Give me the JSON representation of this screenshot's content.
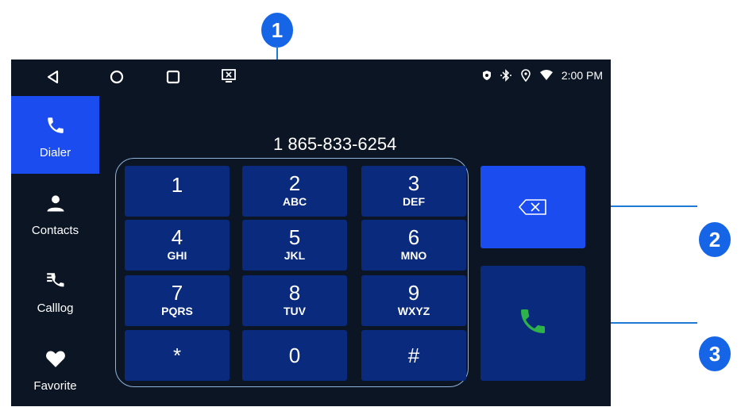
{
  "phone_number": "1 865-833-6254",
  "status": {
    "time": "2:00 PM"
  },
  "sidebar": {
    "items": [
      {
        "label": "Dialer",
        "icon": "phone-icon",
        "active": true
      },
      {
        "label": "Contacts",
        "icon": "person-icon"
      },
      {
        "label": "Calllog",
        "icon": "call-log-icon"
      },
      {
        "label": "Favorite",
        "icon": "heart-icon"
      }
    ]
  },
  "keypad": {
    "keys": [
      {
        "digit": "1",
        "letters": ""
      },
      {
        "digit": "2",
        "letters": "ABC"
      },
      {
        "digit": "3",
        "letters": "DEF"
      },
      {
        "digit": "4",
        "letters": "GHI"
      },
      {
        "digit": "5",
        "letters": "JKL"
      },
      {
        "digit": "6",
        "letters": "MNO"
      },
      {
        "digit": "7",
        "letters": "PQRS"
      },
      {
        "digit": "8",
        "letters": "TUV"
      },
      {
        "digit": "9",
        "letters": "WXYZ"
      },
      {
        "digit": "*",
        "letters": ""
      },
      {
        "digit": "0",
        "letters": ""
      },
      {
        "digit": "#",
        "letters": ""
      }
    ]
  },
  "callouts": [
    "1",
    "2",
    "3"
  ],
  "colors": {
    "screen_bg": "#0c1523",
    "key_bg": "#0a2a7d",
    "accent": "#1a4cf0",
    "call_green": "#2eb34a",
    "callout": "#1565e6"
  }
}
